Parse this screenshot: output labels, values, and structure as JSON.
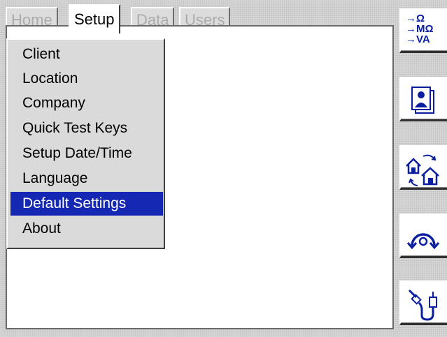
{
  "tabs": [
    {
      "label": "Home",
      "active": false
    },
    {
      "label": "Setup",
      "active": true
    },
    {
      "label": "Data",
      "active": false
    },
    {
      "label": "Users",
      "active": false
    }
  ],
  "setup_menu": {
    "items": [
      {
        "label": "Client"
      },
      {
        "label": "Location"
      },
      {
        "label": "Company"
      },
      {
        "label": "Quick Test Keys"
      },
      {
        "label": "Setup Date/Time"
      },
      {
        "label": "Language"
      },
      {
        "label": "Default Settings",
        "selected": true
      },
      {
        "label": "About"
      }
    ]
  },
  "side_buttons": [
    {
      "icon": "measurement-units-icon",
      "lines": [
        "→Ω",
        "→MΩ",
        "→VA"
      ]
    },
    {
      "icon": "user-card-icon"
    },
    {
      "icon": "location-transfer-icon"
    },
    {
      "icon": "rotate-icon"
    },
    {
      "icon": "probe-icon"
    }
  ],
  "colors": {
    "accent_blue": "#1428b4",
    "icon_blue": "#0a1ea0",
    "selection_text": "#ffffff"
  }
}
